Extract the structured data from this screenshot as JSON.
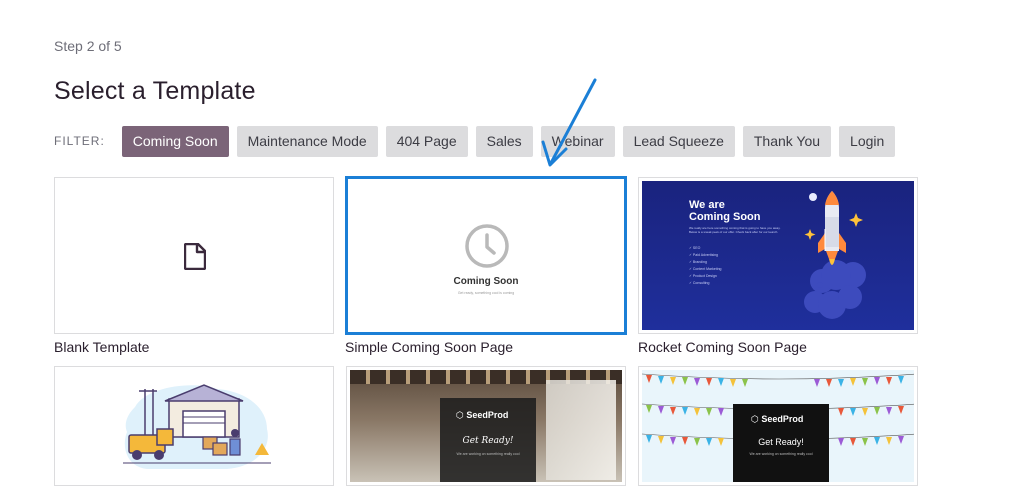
{
  "header": {
    "step": "Step 2 of 5",
    "title": "Select a Template"
  },
  "filter": {
    "label": "FILTER:",
    "active_index": 0,
    "options": [
      "Coming Soon",
      "Maintenance Mode",
      "404 Page",
      "Sales",
      "Webinar",
      "Lead Squeeze",
      "Thank You",
      "Login"
    ]
  },
  "templates": [
    {
      "label": "Blank Template",
      "icon": "document-icon"
    },
    {
      "label": "Simple Coming Soon Page",
      "preview_title": "Coming Soon",
      "preview_sub": "Get ready, something cool is coming",
      "icon": "clock-icon"
    },
    {
      "label": "Rocket Coming Soon Page",
      "preview_title_line1": "We are",
      "preview_title_line2": "Coming Soon",
      "preview_para": "We really are here something coming that is going to have you away. Below is a sneak peek of our offer. Check back after for our launch.",
      "preview_list": [
        "SEO",
        "Paid Advertising",
        "Branding",
        "Content Marketing",
        "Product Design",
        "Consulting"
      ]
    },
    {
      "label": ""
    },
    {
      "label": "",
      "brand": "SeedProd",
      "preview_title": "Get Ready!",
      "preview_sub": "We are working on something really cool"
    },
    {
      "label": "",
      "brand": "SeedProd",
      "preview_title": "Get Ready!",
      "preview_sub": "We are working on something really cool"
    }
  ],
  "colors": {
    "accent_filter": "#7b6478",
    "highlight": "#1b7fd6",
    "rocket_bg": "#1a2a8c"
  }
}
